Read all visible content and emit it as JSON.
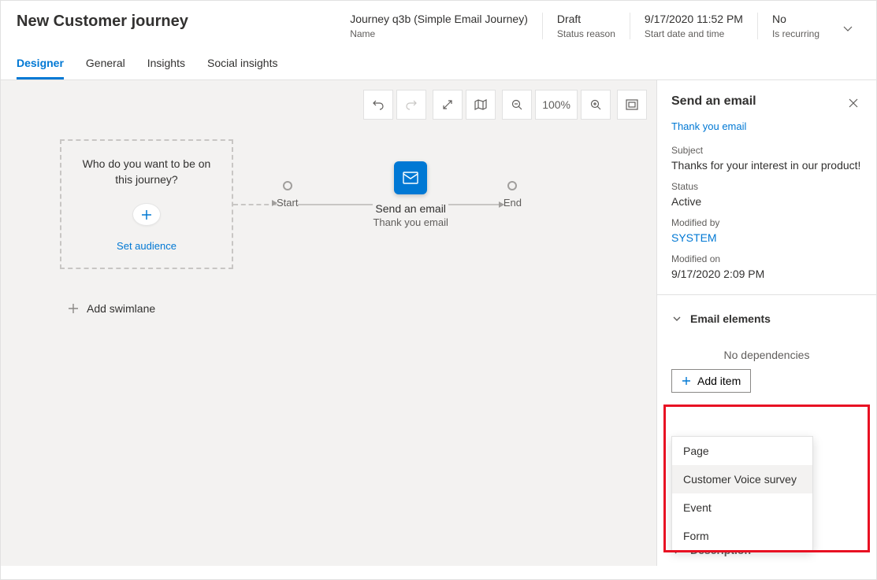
{
  "header": {
    "title": "New Customer journey",
    "meta": [
      {
        "value": "Journey q3b (Simple Email Journey)",
        "label": "Name"
      },
      {
        "value": "Draft",
        "label": "Status reason"
      },
      {
        "value": "9/17/2020 11:52 PM",
        "label": "Start date and time"
      },
      {
        "value": "No",
        "label": "Is recurring"
      }
    ]
  },
  "tabs": [
    "Designer",
    "General",
    "Insights",
    "Social insights"
  ],
  "toolbar": {
    "zoom": "100%"
  },
  "canvas": {
    "audience_prompt": "Who do you want to be on this journey?",
    "set_audience": "Set audience",
    "start_label": "Start",
    "end_label": "End",
    "email_node_title": "Send an email",
    "email_node_sub": "Thank you email",
    "add_swimlane": "Add swimlane"
  },
  "panel": {
    "title": "Send an email",
    "link": "Thank you email",
    "subject_label": "Subject",
    "subject_value": "Thanks for your interest in our product!",
    "status_label": "Status",
    "status_value": "Active",
    "modifiedby_label": "Modified by",
    "modifiedby_value": "SYSTEM",
    "modifiedon_label": "Modified on",
    "modifiedon_value": "9/17/2020 2:09 PM",
    "section_title": "Email elements",
    "no_deps": "No dependencies",
    "add_item": "Add item",
    "menu": [
      "Page",
      "Customer Voice survey",
      "Event",
      "Form"
    ],
    "description": "Description"
  }
}
